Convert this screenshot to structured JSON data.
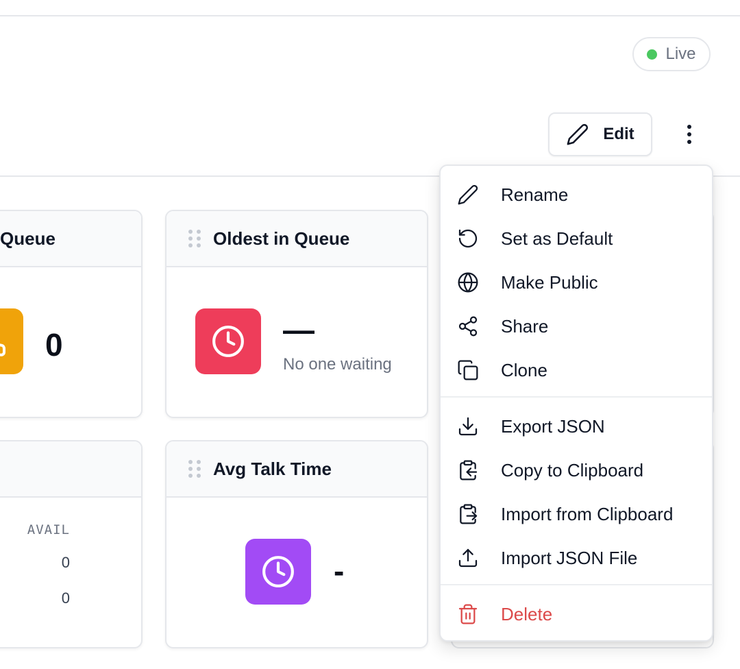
{
  "status": {
    "live_label": "Live",
    "live_color": "#4ac860"
  },
  "toolbar": {
    "edit_label": "Edit"
  },
  "widgets": {
    "queue": {
      "title": "Queue",
      "value": "0",
      "tile_color": "#f0a30a"
    },
    "oldest": {
      "title": "Oldest in Queue",
      "value": "—",
      "subtitle": "No one waiting",
      "tile_color": "#ee3d5a"
    },
    "agents": {
      "column_header": "AVAIL",
      "rows": [
        "0",
        "0"
      ]
    },
    "avg_talk": {
      "title": "Avg Talk Time",
      "value": "-",
      "tile_color": "#a24bf5"
    }
  },
  "menu": {
    "items": [
      {
        "label": "Rename",
        "icon": "pencil-icon"
      },
      {
        "label": "Set as Default",
        "icon": "rotate-ccw-icon"
      },
      {
        "label": "Make Public",
        "icon": "globe-icon"
      },
      {
        "label": "Share",
        "icon": "share-icon"
      },
      {
        "label": "Clone",
        "icon": "copy-icon"
      },
      {
        "label": "Export JSON",
        "icon": "download-icon"
      },
      {
        "label": "Copy to Clipboard",
        "icon": "clipboard-copy-icon"
      },
      {
        "label": "Import from Clipboard",
        "icon": "clipboard-paste-icon"
      },
      {
        "label": "Import JSON File",
        "icon": "upload-icon"
      },
      {
        "label": "Delete",
        "icon": "trash-icon",
        "danger": true
      }
    ]
  }
}
